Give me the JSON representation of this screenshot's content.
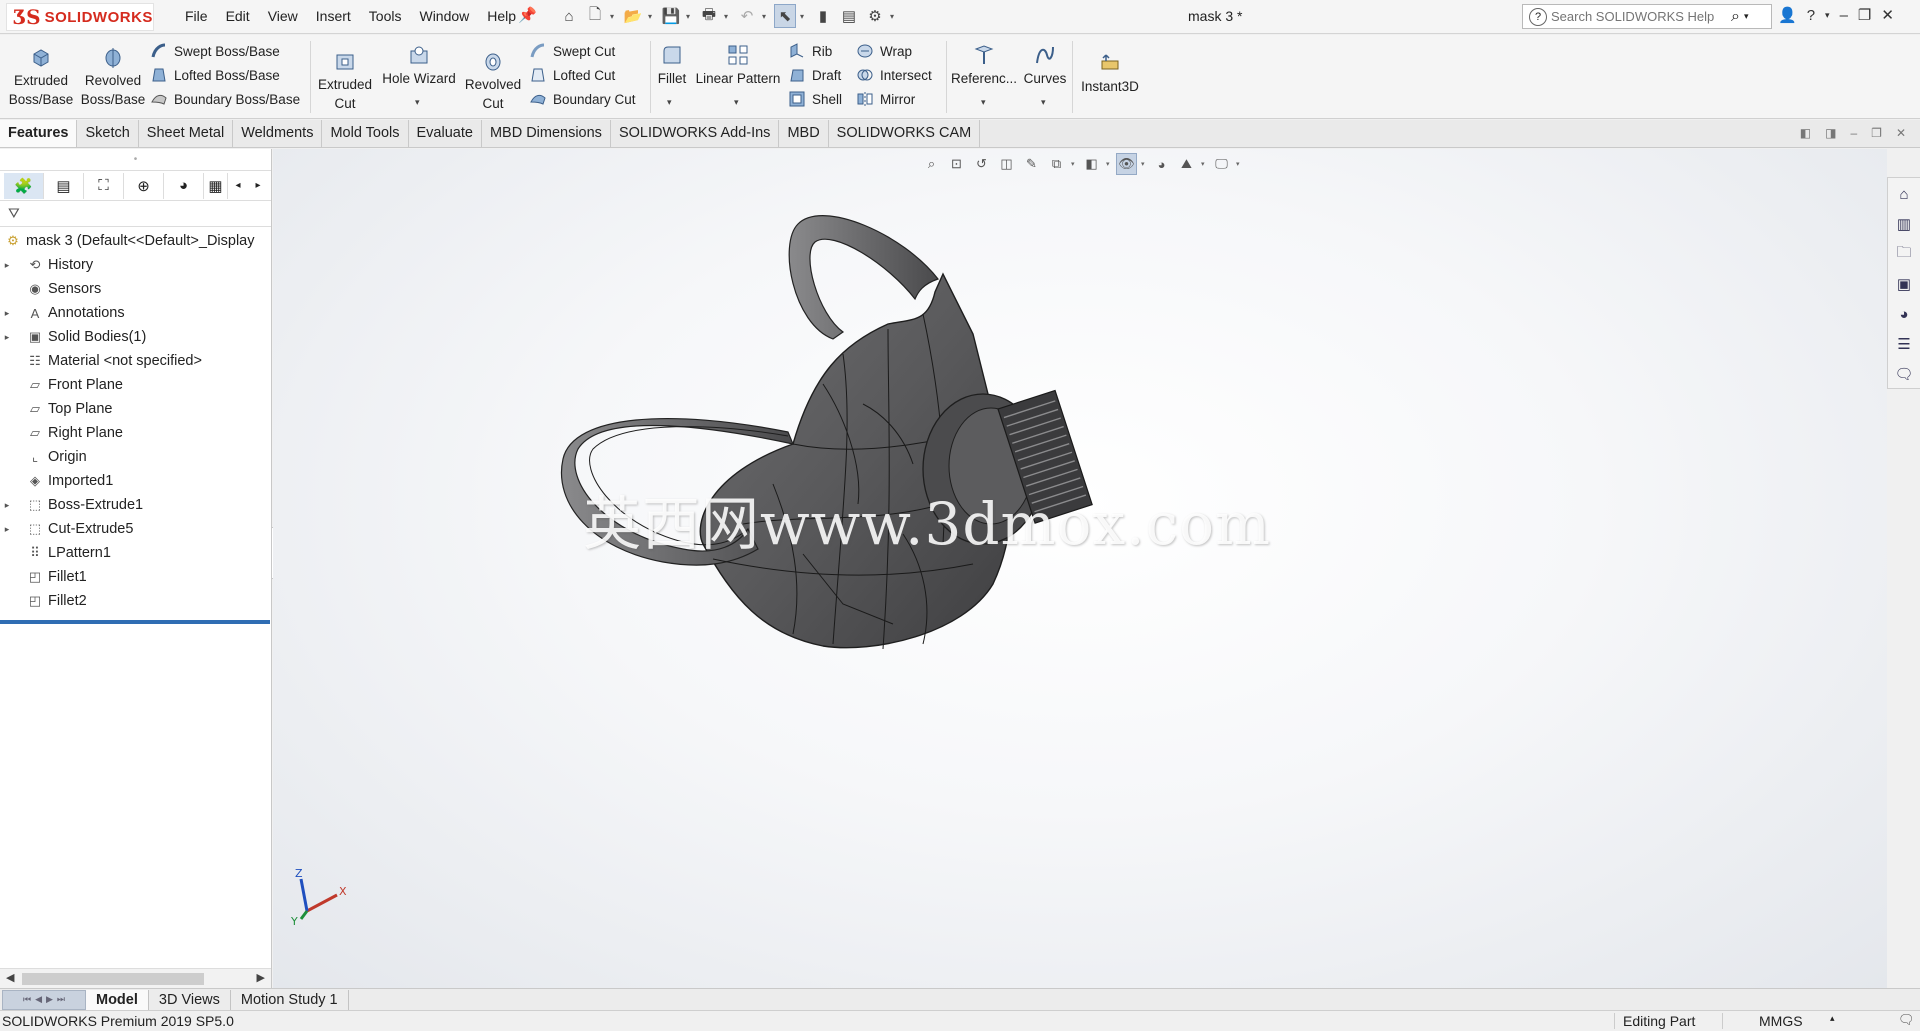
{
  "app": {
    "brand": "SOLIDWORKS",
    "document_title": "mask 3 *"
  },
  "menu": [
    "File",
    "Edit",
    "View",
    "Insert",
    "Tools",
    "Window",
    "Help"
  ],
  "search": {
    "placeholder": "Search SOLIDWORKS Help"
  },
  "ribbon": {
    "extruded_boss": [
      "Extruded",
      "Boss/Base"
    ],
    "revolved_boss": [
      "Revolved",
      "Boss/Base"
    ],
    "swept_boss": "Swept Boss/Base",
    "lofted_boss": "Lofted Boss/Base",
    "boundary_boss": "Boundary Boss/Base",
    "extruded_cut": [
      "Extruded",
      "Cut"
    ],
    "hole_wizard": "Hole Wizard",
    "revolved_cut": [
      "Revolved",
      "Cut"
    ],
    "swept_cut": "Swept Cut",
    "lofted_cut": "Lofted Cut",
    "boundary_cut": "Boundary Cut",
    "fillet": "Fillet",
    "linear_pattern": "Linear Pattern",
    "rib": "Rib",
    "draft": "Draft",
    "shell": "Shell",
    "wrap": "Wrap",
    "intersect": "Intersect",
    "mirror": "Mirror",
    "reference": "Referenc...",
    "curves": "Curves",
    "instant3d": "Instant3D"
  },
  "tabs": [
    "Features",
    "Sketch",
    "Sheet Metal",
    "Weldments",
    "Mold Tools",
    "Evaluate",
    "MBD Dimensions",
    "SOLIDWORKS Add-Ins",
    "MBD",
    "SOLIDWORKS CAM"
  ],
  "tree": {
    "root": "mask 3  (Default<<Default>_Display",
    "items": [
      {
        "label": "History",
        "icon": "history-icon",
        "expandable": true
      },
      {
        "label": "Sensors",
        "icon": "sensors-icon",
        "expandable": false
      },
      {
        "label": "Annotations",
        "icon": "annotations-icon",
        "expandable": true
      },
      {
        "label": "Solid Bodies(1)",
        "icon": "solid-bodies-icon",
        "expandable": true
      },
      {
        "label": "Material <not specified>",
        "icon": "material-icon",
        "expandable": false
      },
      {
        "label": "Front Plane",
        "icon": "plane-icon",
        "expandable": false
      },
      {
        "label": "Top Plane",
        "icon": "plane-icon",
        "expandable": false
      },
      {
        "label": "Right Plane",
        "icon": "plane-icon",
        "expandable": false
      },
      {
        "label": "Origin",
        "icon": "origin-icon",
        "expandable": false
      },
      {
        "label": "Imported1",
        "icon": "imported-icon",
        "expandable": false
      },
      {
        "label": "Boss-Extrude1",
        "icon": "boss-extrude-icon",
        "expandable": true
      },
      {
        "label": "Cut-Extrude5",
        "icon": "cut-extrude-icon",
        "expandable": true
      },
      {
        "label": "LPattern1",
        "icon": "linear-pattern-icon",
        "expandable": false
      },
      {
        "label": "Fillet1",
        "icon": "fillet-icon",
        "expandable": false
      },
      {
        "label": "Fillet2",
        "icon": "fillet-icon",
        "expandable": false
      }
    ]
  },
  "viewport": {
    "watermark": "英西网www.3dmox.com",
    "triad": {
      "x": "X",
      "y": "Y",
      "z": "Z"
    }
  },
  "bottom_tabs": [
    "Model",
    "3D Views",
    "Motion Study 1"
  ],
  "status": {
    "product": "SOLIDWORKS Premium 2019 SP5.0",
    "mode": "Editing Part",
    "units": "MMGS"
  },
  "colors": {
    "brand_red": "#d52b1e",
    "selection_blue": "#2f6db3",
    "model_gray": "#5a5a5c"
  }
}
